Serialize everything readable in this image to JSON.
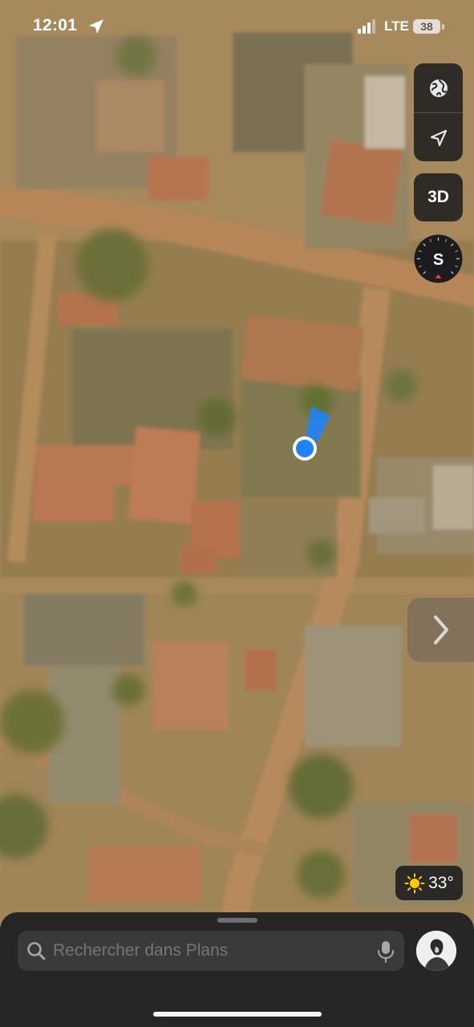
{
  "status_bar": {
    "time": "12:01",
    "network": "LTE",
    "battery": "38"
  },
  "map_controls": {
    "globe": "globe-icon",
    "locate": "location-arrow-icon",
    "mode_3d_label": "3D",
    "compass_letter": "S"
  },
  "weather": {
    "temperature": "33°",
    "icon": "sun-icon"
  },
  "search": {
    "placeholder": "Rechercher dans Plans"
  },
  "colors": {
    "user_location": "#1a84ff",
    "sheet_background": "#262626",
    "control_background": "#1c1c1e"
  }
}
